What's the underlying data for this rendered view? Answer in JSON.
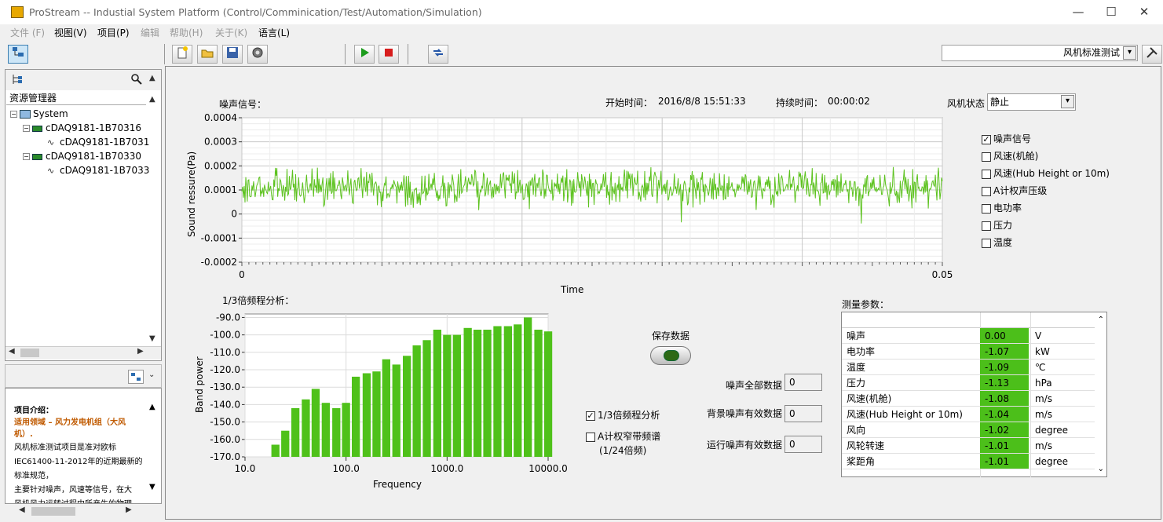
{
  "window": {
    "title": "ProStream -- Industial System Platform (Control/Comminication/Test/Automation/Simulation)",
    "min_glyph": "—",
    "max_glyph": "☐",
    "close_glyph": "✕"
  },
  "menu": [
    {
      "label": "文件 (F)",
      "enabled": false
    },
    {
      "label": "视图(V)",
      "enabled": true
    },
    {
      "label": "项目(P)",
      "enabled": true
    },
    {
      "label": "编辑",
      "enabled": false
    },
    {
      "label": "帮助(H)",
      "enabled": false
    },
    {
      "label": "关于(K)",
      "enabled": false
    },
    {
      "label": "语言(L)",
      "enabled": true
    }
  ],
  "toolbar": {
    "combo_value": "风机标准测试",
    "icons": [
      "tree-toggle-icon",
      "new-project-icon",
      "open-folder-icon",
      "save-icon",
      "settings-gear-icon",
      "run-icon",
      "stop-icon",
      "swap-icon",
      "tools-icon"
    ]
  },
  "tree": {
    "header": "资源管理器",
    "items": [
      {
        "label": "System",
        "level": 0,
        "kind": "system"
      },
      {
        "label": "cDAQ9181-1B70316",
        "level": 1,
        "kind": "device"
      },
      {
        "label": "cDAQ9181-1B7031",
        "level": 2,
        "kind": "channel"
      },
      {
        "label": "cDAQ9181-1B70330",
        "level": 1,
        "kind": "device"
      },
      {
        "label": "cDAQ9181-1B7033",
        "level": 2,
        "kind": "channel"
      }
    ]
  },
  "info": {
    "heading": "项目介绍：",
    "domain_line": "适用领域 – 风力发电机组（大风机）.",
    "lines": [
      "风机标准测试项目是准对欧标",
      "IEC61400-11-2012年的近期最新的",
      "标准规范，",
      "主要针对噪声，风速等信号，在大",
      "风机风力运转过程中所产生的物理"
    ]
  },
  "signal": {
    "title": "噪声信号：",
    "start_label": "开始时间：",
    "start_value": "2016/8/8 15:51:33",
    "duration_label": "持续时间：",
    "duration_value": "00:00:02",
    "state_label": "风机状态",
    "state_value": "静止"
  },
  "checks": [
    {
      "label": "噪声信号",
      "checked": true
    },
    {
      "label": "风速(机舱)",
      "checked": false
    },
    {
      "label": "风速(Hub Height or 10m)",
      "checked": false
    },
    {
      "label": "A计权声压级",
      "checked": false
    },
    {
      "label": "电功率",
      "checked": false
    },
    {
      "label": "压力",
      "checked": false
    },
    {
      "label": "温度",
      "checked": false
    }
  ],
  "octave": {
    "title": "1/3倍频程分析：",
    "save_label": "保存数据",
    "opt1": "1/3倍频程分析",
    "opt1_checked": true,
    "opt2a": "A计权窄带频谱",
    "opt2b": "(1/24倍频)",
    "opt2_checked": false
  },
  "counts": [
    {
      "label": "噪声全部数据",
      "value": "0"
    },
    {
      "label": "背景噪声有效数据",
      "value": "0"
    },
    {
      "label": "运行噪声有效数据",
      "value": "0"
    }
  ],
  "params": {
    "title": "测量参数：",
    "rows": [
      {
        "name": "噪声",
        "value": "0.00",
        "unit": "V"
      },
      {
        "name": "电功率",
        "value": "-1.07",
        "unit": "kW"
      },
      {
        "name": "温度",
        "value": "-1.09",
        "unit": "℃"
      },
      {
        "name": "压力",
        "value": "-1.13",
        "unit": "hPa"
      },
      {
        "name": "风速(机舱)",
        "value": "-1.08",
        "unit": "m/s"
      },
      {
        "name": "风速(Hub Height or 10m)",
        "value": "-1.04",
        "unit": "m/s"
      },
      {
        "name": "风向",
        "value": "-1.02",
        "unit": "degree"
      },
      {
        "name": "风轮转速",
        "value": "-1.01",
        "unit": "m/s"
      },
      {
        "name": "桨距角",
        "value": "-1.01",
        "unit": "degree"
      }
    ]
  },
  "colors": {
    "plot_green": "#5cc21e",
    "bar_green": "#4fc11a",
    "value_green": "#4cbf1a"
  },
  "chart_data": [
    {
      "type": "line",
      "xlabel": "Time",
      "ylabel": "Sound ressure(Pa)",
      "xlim": [
        0,
        0.05
      ],
      "ylim": [
        -0.0002,
        0.0004
      ],
      "x_ticks": [
        "0",
        "0.05"
      ],
      "y_ticks": [
        "-0.0002",
        "-0.0001",
        "0",
        "0.0001",
        "0.0002",
        "0.0003",
        "0.0004"
      ],
      "grid": true,
      "series": [
        {
          "approx_mean": 0.00011,
          "approx_min": -0.00013,
          "approx_max": 0.00038,
          "samples": 900
        }
      ]
    },
    {
      "type": "bar",
      "xlabel": "Frequency",
      "ylabel": "Band power",
      "x_scale": "log",
      "xlim": [
        10,
        10000
      ],
      "ylim": [
        -170,
        -88
      ],
      "x_ticks": [
        "10.0",
        "100.0",
        "1000.0",
        "10000.0"
      ],
      "y_ticks": [
        "-90.0",
        "-100.0",
        "-110.0",
        "-120.0",
        "-130.0",
        "-140.0",
        "-150.0",
        "-160.0",
        "-170.0"
      ],
      "grid": true,
      "frequencies": [
        20,
        25,
        31.5,
        40,
        50,
        63,
        80,
        100,
        125,
        160,
        200,
        250,
        315,
        400,
        500,
        630,
        800,
        1000,
        1250,
        1600,
        2000,
        2500,
        3150,
        4000,
        5000,
        6300,
        8000,
        10000
      ],
      "values": [
        -163,
        -155,
        -142,
        -137,
        -131,
        -139,
        -142,
        -139,
        -124,
        -122,
        -121,
        -114,
        -117,
        -112,
        -106,
        -103,
        -97,
        -100,
        -100,
        -96,
        -97,
        -97,
        -95,
        -95,
        -94,
        -90,
        -97,
        -98
      ]
    }
  ]
}
